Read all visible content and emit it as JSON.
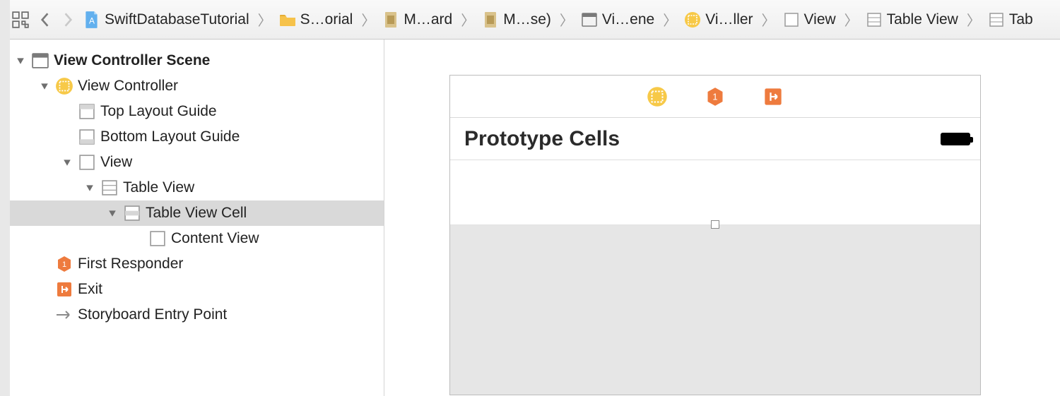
{
  "toolbar": {
    "related_items": "related-items",
    "nav_back": "back",
    "nav_forward": "forward"
  },
  "breadcrumb": [
    {
      "icon": "app",
      "label": "SwiftDatabaseTutorial"
    },
    {
      "icon": "folder",
      "label": "S…orial"
    },
    {
      "icon": "storyboard",
      "label": "M…ard"
    },
    {
      "icon": "storyboard",
      "label": "M…se)"
    },
    {
      "icon": "scene",
      "label": "Vi…ene"
    },
    {
      "icon": "controller",
      "label": "Vi…ller"
    },
    {
      "icon": "view",
      "label": "View"
    },
    {
      "icon": "tableview",
      "label": "Table View"
    },
    {
      "icon": "tableview",
      "label": "Tab"
    }
  ],
  "outline": {
    "scene": "View Controller Scene",
    "controller": "View Controller",
    "top_guide": "Top Layout Guide",
    "bottom_guide": "Bottom Layout Guide",
    "view": "View",
    "table_view": "Table View",
    "table_view_cell": "Table View Cell",
    "content_view": "Content View",
    "first_responder": "First Responder",
    "exit": "Exit",
    "entry_point": "Storyboard Entry Point"
  },
  "canvas": {
    "header": "Prototype Cells"
  },
  "colors": {
    "folder": "#f4b63f",
    "controller": "#f7c948",
    "responder": "#ee7b3e",
    "exit": "#ee7b3e",
    "app_icon": "#4aa3e6"
  }
}
